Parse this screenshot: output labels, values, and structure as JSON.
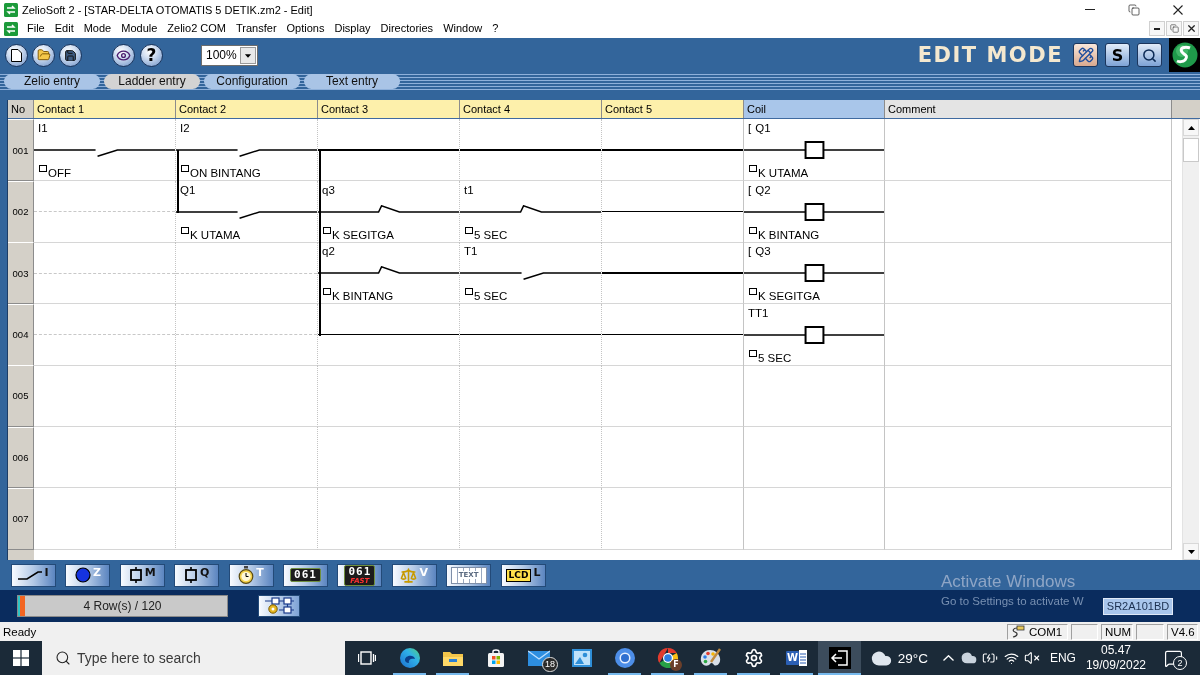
{
  "window": {
    "title": "ZelioSoft 2 - [STAR-DELTA OTOMATIS 5 DETIK.zm2 - Edit]"
  },
  "menu_bar": {
    "items": [
      "File",
      "Edit",
      "Mode",
      "Module",
      "Zelio2 COM",
      "Transfer",
      "Options",
      "Display",
      "Directories",
      "Window",
      "?"
    ]
  },
  "toolbar": {
    "help": "?",
    "zoom": "100%",
    "mode": "EDIT MODE",
    "simulation": "S"
  },
  "entry_tabs": [
    {
      "label": "Zelio entry",
      "selected": false
    },
    {
      "label": "Ladder entry",
      "selected": true
    },
    {
      "label": "Configuration",
      "selected": false
    },
    {
      "label": "Text entry",
      "selected": false
    }
  ],
  "ladder": {
    "columns": [
      {
        "label": "No",
        "kind": "number"
      },
      {
        "label": "Contact 1",
        "kind": "contact"
      },
      {
        "label": "Contact 2",
        "kind": "contact"
      },
      {
        "label": "Contact 3",
        "kind": "contact"
      },
      {
        "label": "Contact 4",
        "kind": "contact"
      },
      {
        "label": "Contact 5",
        "kind": "contact"
      },
      {
        "label": "Coil",
        "kind": "coil"
      },
      {
        "label": "Comment",
        "kind": "comment"
      }
    ],
    "rungs": [
      {
        "number": "001",
        "cells": [
          {
            "kind": "no_contact",
            "address": "I1",
            "comment": "OFF",
            "link_up": false
          },
          {
            "kind": "no_contact",
            "address": "I2",
            "comment": "ON BINTANG",
            "link_up": false
          },
          {
            "kind": "wire",
            "link_up": false
          },
          {
            "kind": "wire",
            "link_up": false
          },
          {
            "kind": "wire",
            "link_up": false
          }
        ],
        "coil": {
          "function": "[",
          "address": "Q1",
          "comment": "K UTAMA"
        }
      },
      {
        "number": "002",
        "cells": [
          {
            "kind": "empty",
            "link_up": false
          },
          {
            "kind": "no_contact",
            "address": "Q1",
            "comment": "K UTAMA",
            "link_up": true
          },
          {
            "kind": "nc_contact",
            "address": "q3",
            "comment": "K SEGITGA",
            "link_up": true
          },
          {
            "kind": "nc_contact",
            "address": "t1",
            "comment": "5 SEC",
            "link_up": false
          },
          {
            "kind": "wire",
            "link_up": false
          }
        ],
        "coil": {
          "function": "[",
          "address": "Q2",
          "comment": "K BINTANG"
        }
      },
      {
        "number": "003",
        "cells": [
          {
            "kind": "empty",
            "link_up": false
          },
          {
            "kind": "empty",
            "link_up": false
          },
          {
            "kind": "nc_contact",
            "address": "q2",
            "comment": "K BINTANG",
            "link_up": true
          },
          {
            "kind": "no_contact",
            "address": "T1",
            "comment": "5 SEC",
            "link_up": false
          },
          {
            "kind": "wire",
            "link_up": false
          }
        ],
        "coil": {
          "function": "[",
          "address": "Q3",
          "comment": "K SEGITGA"
        }
      },
      {
        "number": "004",
        "cells": [
          {
            "kind": "empty",
            "link_up": false
          },
          {
            "kind": "empty",
            "link_up": false
          },
          {
            "kind": "wire",
            "link_up": true
          },
          {
            "kind": "wire",
            "link_up": false
          },
          {
            "kind": "wire",
            "link_up": false
          }
        ],
        "coil": {
          "address": "TT1",
          "comment": "5 SEC"
        }
      },
      {
        "number": "005"
      },
      {
        "number": "006"
      },
      {
        "number": "007"
      }
    ]
  },
  "palette": [
    {
      "kind": "contact",
      "letter": "I"
    },
    {
      "kind": "key",
      "letter": "Z"
    },
    {
      "kind": "relay",
      "letter": "M"
    },
    {
      "kind": "output",
      "letter": "Q"
    },
    {
      "kind": "timer",
      "letter": "T"
    },
    {
      "kind": "counter",
      "digits": "061"
    },
    {
      "kind": "fast_counter",
      "digits": "061",
      "caption": "FAST"
    },
    {
      "kind": "comparator",
      "letter": "V"
    },
    {
      "kind": "text",
      "caption": "TEXT"
    },
    {
      "kind": "lcd",
      "caption": "LCD",
      "letter": "L"
    }
  ],
  "program_bar": {
    "rows": "4 Row(s) / 120",
    "level": 0.033,
    "module": "SR2A101BD"
  },
  "activation_notice": {
    "title": "Activate Windows",
    "hint": "Go to Settings to activate W"
  },
  "status_bar": {
    "message": "Ready",
    "port": "COM1",
    "num": "NUM",
    "version": "V4.6"
  },
  "taskbar": {
    "search": {
      "placeholder": "Type here to search"
    },
    "apps": [
      {
        "kind": "task_view",
        "running": false,
        "selected": false
      },
      {
        "kind": "edge",
        "running": true,
        "selected": false
      },
      {
        "kind": "explorer",
        "running": true,
        "selected": false
      },
      {
        "kind": "store",
        "running": false,
        "selected": false
      },
      {
        "kind": "mail",
        "badge": "18",
        "running": false,
        "selected": false
      },
      {
        "kind": "photos",
        "running": false,
        "selected": false
      },
      {
        "kind": "chromium",
        "running": true,
        "selected": false
      },
      {
        "kind": "chrome",
        "badge": "F",
        "running": true,
        "selected": false
      },
      {
        "kind": "paint",
        "running": true,
        "selected": false
      },
      {
        "kind": "settings",
        "running": true,
        "selected": false
      },
      {
        "kind": "word",
        "letter": "W",
        "running": true,
        "selected": false
      },
      {
        "kind": "exit",
        "running": true,
        "selected": true
      }
    ],
    "weather": "29°C",
    "language": "ENG",
    "time": "05.47",
    "date": "19/09/2022",
    "notifications": "2"
  }
}
